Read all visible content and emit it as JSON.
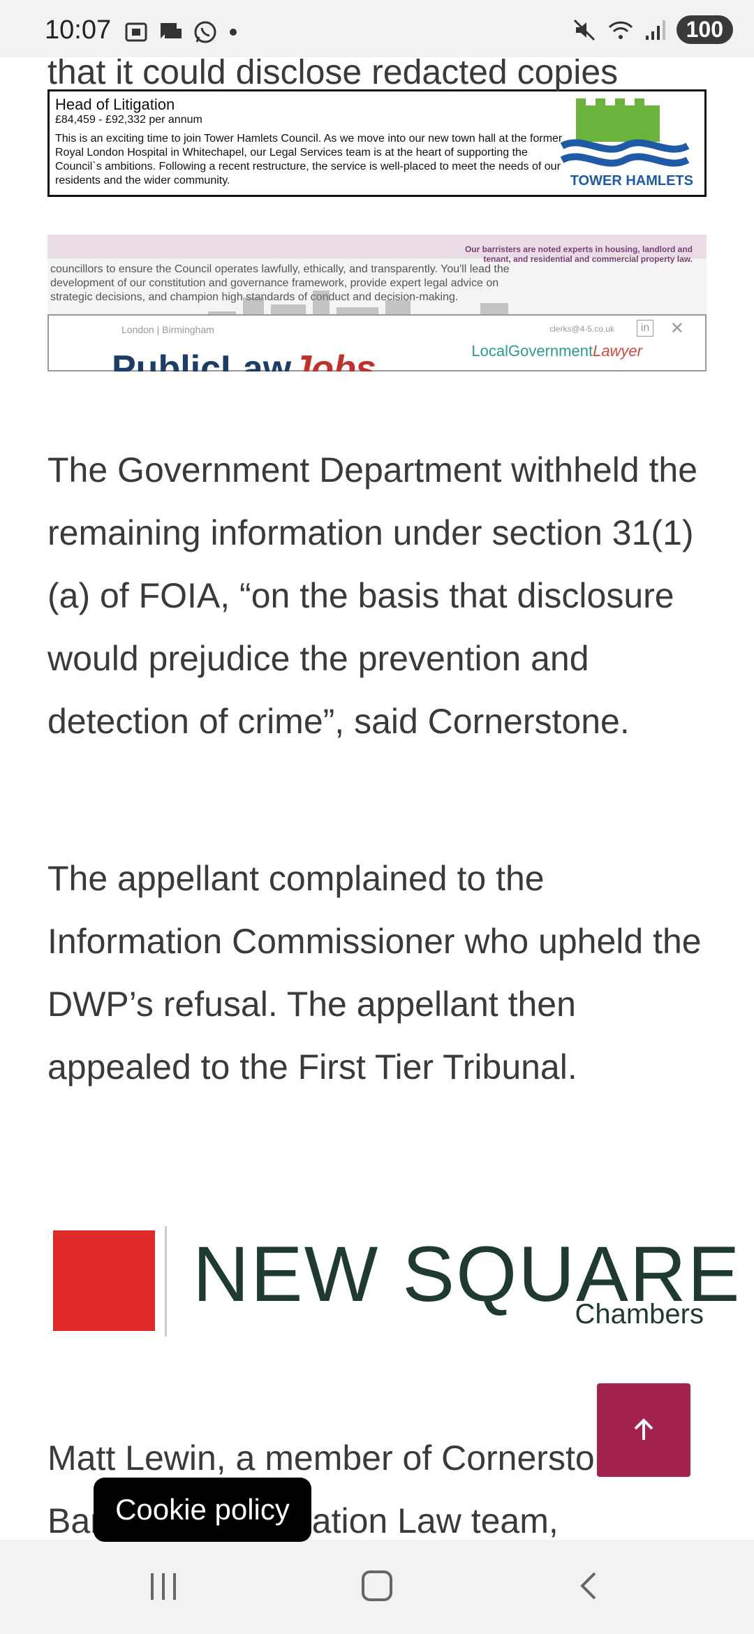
{
  "status_bar": {
    "time": "10:07",
    "left_icons": [
      "screenshot-icon",
      "chat-icon",
      "whatsapp-icon",
      "dot-icon"
    ],
    "right_icons": [
      "mute-icon",
      "wifi-icon",
      "signal-icon"
    ],
    "battery": "100"
  },
  "cut_text": "that it could disclose redacted copies",
  "ad_tower": {
    "title": "Head of Litigation",
    "salary": "£84,459 - £92,332 per annum",
    "body": "This is an exciting time to join Tower Hamlets Council. As we move into our new town hall at the former Royal London Hospital in Whitechapel, our Legal Services team is at the heart of supporting the Council`s ambitions. Following a recent restructure, the service is well-placed to meet the needs of our residents and the wider community.",
    "logo_text": "TOWER HAMLETS"
  },
  "ad_mixed": {
    "body": "councillors to ensure the Council operates lawfully, ethically, and transparently. You'll lead the development of our constitution and governance framework, provide expert legal advice on strategic decisions, and champion high standards of conduct and decision-making.",
    "right_text": "Our barristers are noted experts in housing, landlord and tenant, and residential and commercial property law.",
    "location": "London | Birmingham",
    "email": "clerks@4-5.co.uk",
    "brand_a": "LocalGovernment",
    "brand_b": "Lawyer",
    "plj_a": "PublicLaw",
    "plj_b": "Jobs"
  },
  "paragraphs": {
    "p1": "The Government Department withheld the remaining information under section 31(1)(a) of FOIA, “on the basis that disclosure would prejudice the prevention and detection of crime”, said Cornerstone.",
    "p2": "The appellant complained to the Information Commissioner who upheld the DWP’s refusal. The appellant then appealed to the First Tier Tribunal.",
    "p3": "Matt Lewin, a member of Cornerstone Barristers’ Information Law team,"
  },
  "logo_nsc": {
    "name": "NEW SQUARE",
    "sub": "Chambers"
  },
  "back_to_top": {
    "icon": "arrow-up-icon"
  },
  "cookie": {
    "label": "Cookie policy"
  },
  "nav": {
    "recent": "recent-apps-icon",
    "home": "home-icon",
    "back": "back-icon"
  },
  "colors": {
    "back_to_top_bg": "#a3234f",
    "nsc_red": "#e02a27",
    "text": "#3a3a3a"
  }
}
